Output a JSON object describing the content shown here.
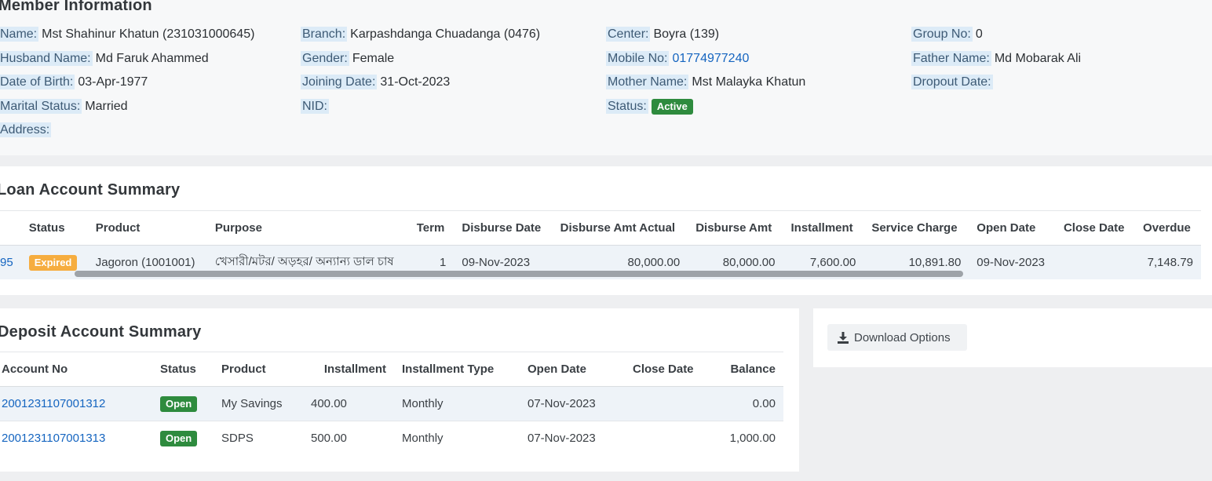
{
  "member": {
    "title": "Member Information",
    "fields": {
      "name": {
        "label": "Name:",
        "value": "Mst Shahinur Khatun (231031000645)"
      },
      "branch": {
        "label": "Branch:",
        "value": "Karpashdanga Chuadanga (0476)"
      },
      "center": {
        "label": "Center:",
        "value": "Boyra (139)"
      },
      "group_no": {
        "label": "Group No:",
        "value": "0"
      },
      "husband": {
        "label": "Husband Name:",
        "value": "Md Faruk Ahammed"
      },
      "gender": {
        "label": "Gender:",
        "value": "Female"
      },
      "mobile": {
        "label": "Mobile No:",
        "value": "01774977240"
      },
      "father": {
        "label": "Father Name:",
        "value": "Md Mobarak Ali"
      },
      "dob": {
        "label": "Date of Birth:",
        "value": "03-Apr-1977"
      },
      "joining": {
        "label": "Joining Date:",
        "value": "31-Oct-2023"
      },
      "mother": {
        "label": "Mother Name:",
        "value": "Mst Malayka Khatun"
      },
      "dropout": {
        "label": "Dropout Date:",
        "value": ""
      },
      "marital": {
        "label": "Marital Status:",
        "value": "Married"
      },
      "nid": {
        "label": "NID:",
        "value": ""
      },
      "status": {
        "label": "Status:",
        "value": "Active"
      },
      "address": {
        "label": "Address:",
        "value": ""
      }
    }
  },
  "loan": {
    "title": "Loan Account Summary",
    "columns": [
      "Status",
      "Product",
      "Purpose",
      "Term",
      "Disburse Date",
      "Disburse Amt Actual",
      "Disburse Amt",
      "Installment",
      "Service Charge",
      "Open Date",
      "Close Date",
      "Overdue"
    ],
    "rows": [
      {
        "account": "95",
        "status": "Expired",
        "product": "Jagoron (1001001)",
        "purpose": "খেসারী/মটর/ অড়হর/ অন্যান্য ডাল চাষ",
        "term": "1",
        "disburse_date": "09-Nov-2023",
        "disburse_amt_actual": "80,000.00",
        "disburse_amt": "80,000.00",
        "installment": "7,600.00",
        "service_charge": "10,891.80",
        "open_date": "09-Nov-2023",
        "close_date": "",
        "overdue": "7,148.79"
      }
    ]
  },
  "deposit": {
    "title": "Deposit Account Summary",
    "columns": [
      "Account No",
      "Status",
      "Product",
      "Installment",
      "Installment Type",
      "Open Date",
      "Close Date",
      "Balance"
    ],
    "rows": [
      {
        "account": "2001231107001312",
        "status": "Open",
        "product": "My Savings",
        "installment": "400.00",
        "type": "Monthly",
        "open_date": "07-Nov-2023",
        "close_date": "",
        "balance": "0.00"
      },
      {
        "account": "2001231107001313",
        "status": "Open",
        "product": "SDPS",
        "installment": "500.00",
        "type": "Monthly",
        "open_date": "07-Nov-2023",
        "close_date": "",
        "balance": "1,000.00"
      }
    ]
  },
  "download": {
    "label": "Download Options",
    "icon": "download-icon"
  },
  "colors": {
    "active_badge": "#2e8b3e",
    "expired_badge": "#f6ad3f",
    "link": "#1565c0",
    "label_bg": "#dcebf7"
  }
}
